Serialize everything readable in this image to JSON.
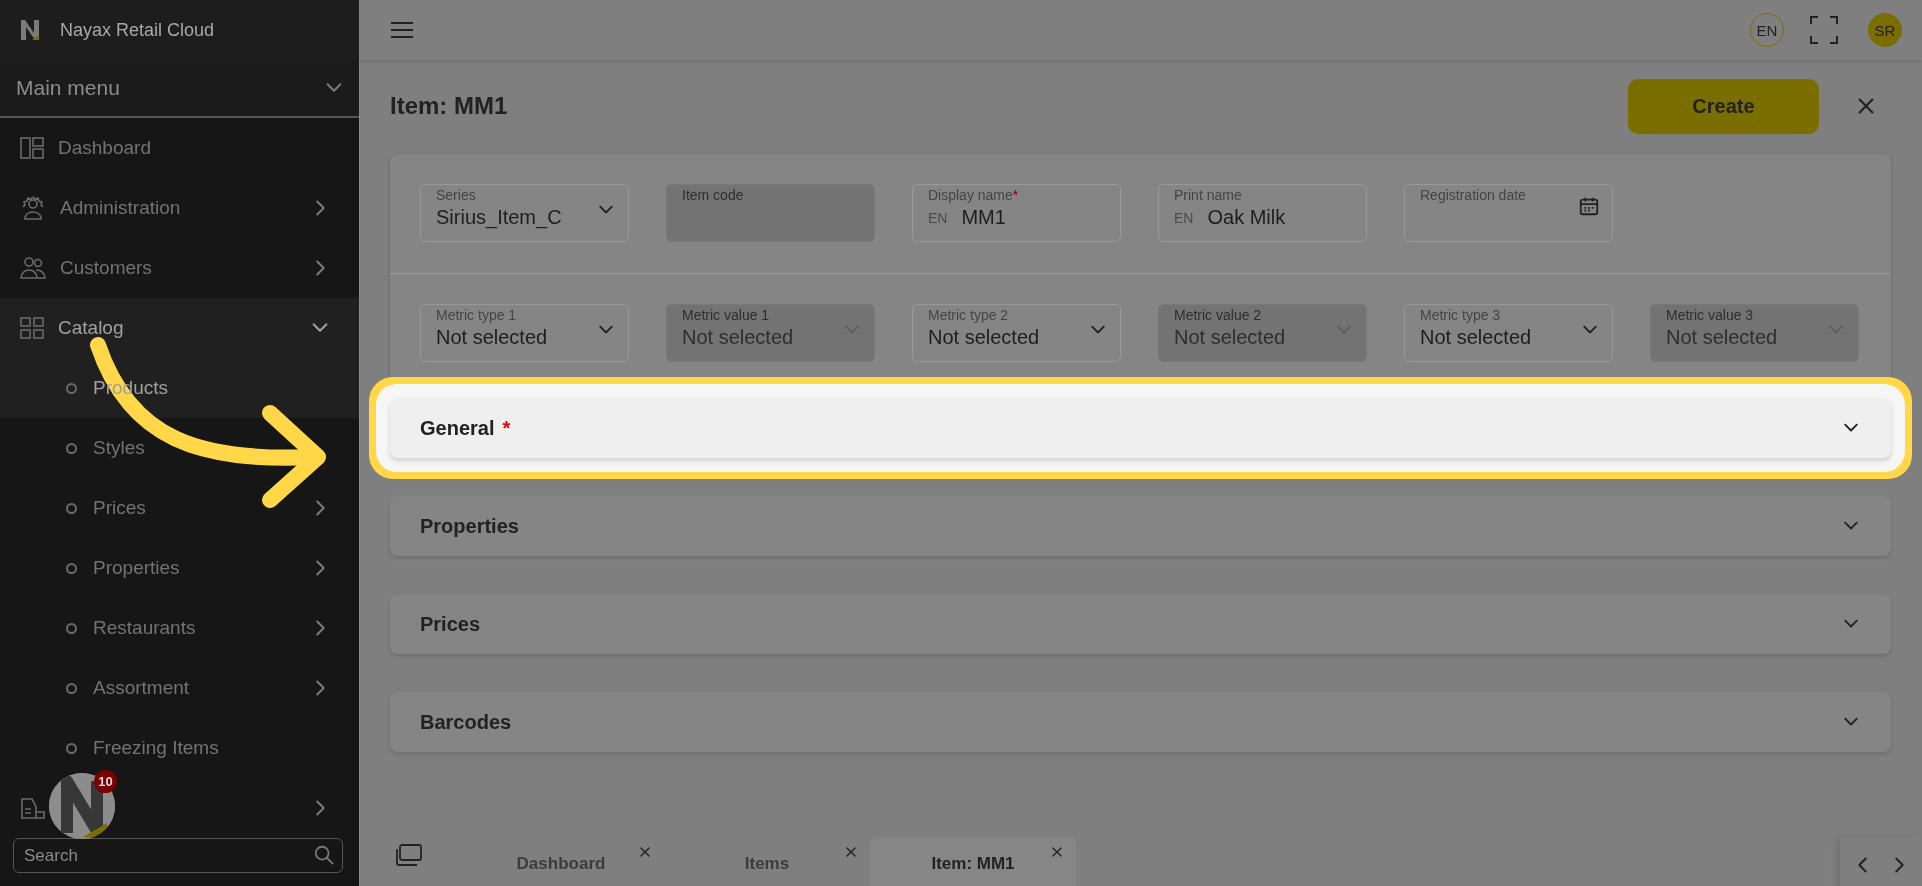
{
  "app": {
    "title": "Nayax Retail Cloud"
  },
  "sidebar": {
    "menu_title": "Main menu",
    "menu_expanded": true,
    "items": [
      {
        "label": "Dashboard",
        "selected": false
      },
      {
        "label": "Administration",
        "selected": false,
        "expanded": false
      },
      {
        "label": "Customers",
        "selected": false,
        "expanded": false
      },
      {
        "label": "Catalog",
        "selected": true,
        "expanded": true,
        "children": [
          {
            "label": "Products",
            "selected": true
          },
          {
            "label": "Styles",
            "selected": false
          },
          {
            "label": "Prices",
            "selected": false,
            "expanded": false
          },
          {
            "label": "Properties",
            "selected": false,
            "expanded": false
          },
          {
            "label": "Restaurants",
            "selected": false,
            "expanded": false
          },
          {
            "label": "Assortment",
            "selected": false,
            "expanded": false
          },
          {
            "label": "Freezing Items",
            "selected": false
          }
        ]
      },
      {
        "selected": false,
        "expanded": false
      }
    ],
    "search": {
      "placeholder": "Search"
    }
  },
  "floating_button": {
    "badge": "10"
  },
  "topbar": {
    "language": "EN",
    "user_initials": "SR"
  },
  "page": {
    "title": "Item: MM1",
    "create_button": "Create"
  },
  "fields": [
    [
      {
        "label": "Series",
        "value": "Sirius_Item_C",
        "kind": "select",
        "disabled": false
      },
      {
        "label": "Item code",
        "kind": "text",
        "disabled": true
      },
      {
        "label": "Display name",
        "prefix": "EN",
        "value": "MM1",
        "kind": "text",
        "required_mark": "*",
        "disabled": false
      },
      {
        "label": "Print name",
        "prefix": "EN",
        "value": "Oak Milk",
        "kind": "text",
        "disabled": false
      },
      {
        "label": "Registration date",
        "kind": "date",
        "disabled": false
      }
    ],
    [
      {
        "label": "Metric type 1",
        "value": "Not selected",
        "kind": "select",
        "disabled": false
      },
      {
        "label": "Metric value 1",
        "value": "Not selected",
        "kind": "select",
        "disabled": true
      },
      {
        "label": "Metric type 2",
        "value": "Not selected",
        "kind": "select",
        "disabled": false
      },
      {
        "label": "Metric value 2",
        "value": "Not selected",
        "kind": "select",
        "disabled": true
      },
      {
        "label": "Metric type 3",
        "value": "Not selected",
        "kind": "select",
        "disabled": false
      },
      {
        "label": "Metric value 3",
        "value": "Not selected",
        "kind": "select",
        "disabled": true
      }
    ]
  ],
  "sections": [
    {
      "title": "General",
      "required_mark": "*",
      "highlighted": true,
      "expanded": false
    },
    {
      "title": "Properties",
      "highlighted": false,
      "expanded": false
    },
    {
      "title": "Prices",
      "highlighted": false,
      "expanded": false
    },
    {
      "title": "Barcodes",
      "highlighted": false,
      "expanded": false
    }
  ],
  "tabs": [
    {
      "label": "Dashboard",
      "selected": false
    },
    {
      "label": "Items",
      "selected": false
    },
    {
      "label": "Item: MM1",
      "selected": true
    }
  ]
}
